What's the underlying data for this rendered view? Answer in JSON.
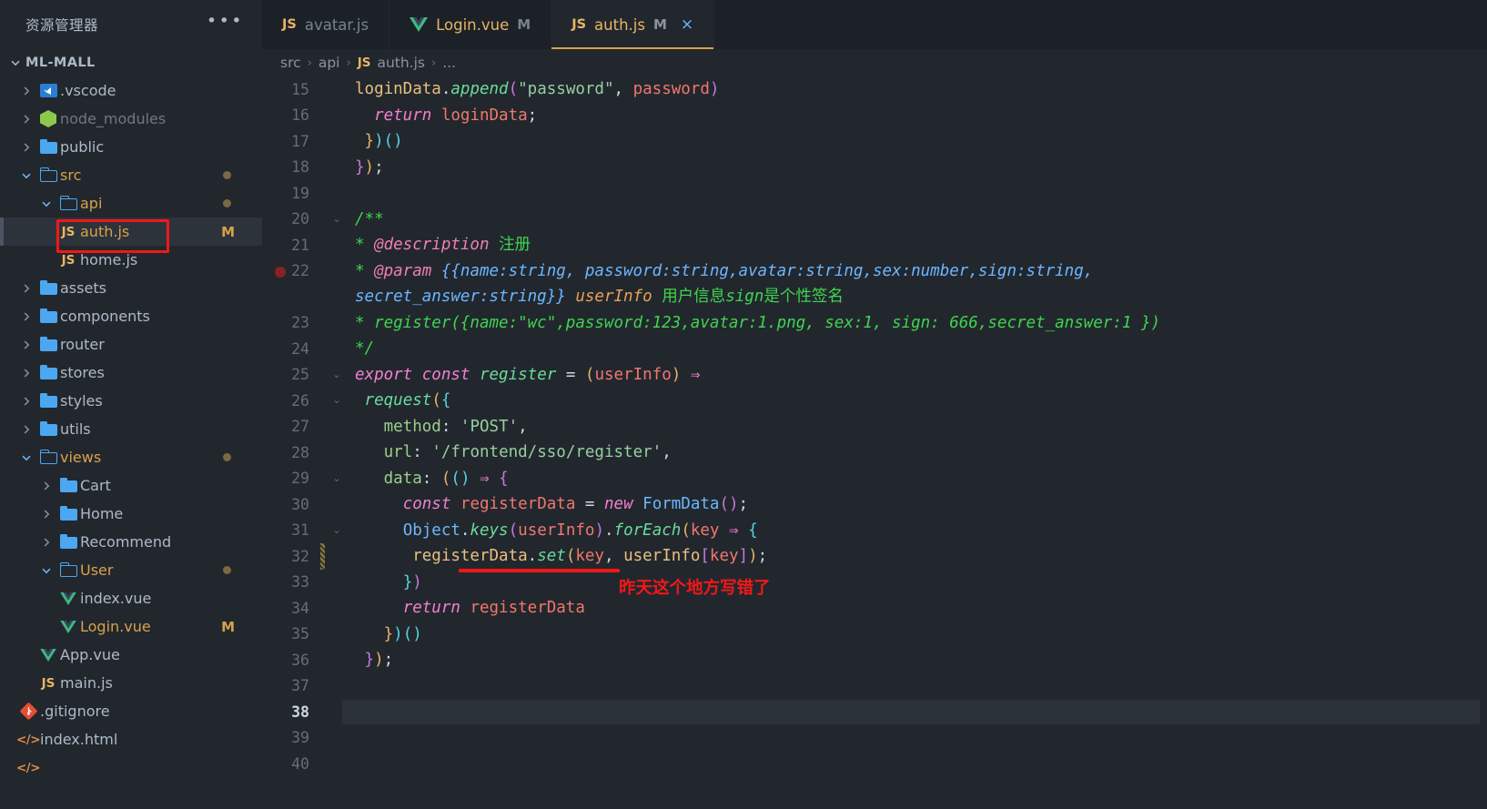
{
  "sidebar": {
    "header_title": "资源管理器",
    "more_icon": "ellipsis-icon",
    "root_label": "ML-MALL",
    "items": [
      {
        "label": ".vscode",
        "indent": 1,
        "type": "folder-vscode",
        "state": "collapsed",
        "badge": "",
        "dot": false
      },
      {
        "label": "node_modules",
        "indent": 1,
        "type": "folder-node",
        "state": "collapsed",
        "badge": "",
        "dot": false,
        "muted": true
      },
      {
        "label": "public",
        "indent": 1,
        "type": "folder",
        "state": "collapsed",
        "badge": "",
        "dot": false
      },
      {
        "label": "src",
        "indent": 1,
        "type": "folder-open",
        "state": "expanded",
        "badge": "",
        "dot": true
      },
      {
        "label": "api",
        "indent": 2,
        "type": "folder-open",
        "state": "expanded",
        "badge": "",
        "dot": true
      },
      {
        "label": "auth.js",
        "indent": 3,
        "type": "js",
        "state": "file",
        "badge": "M",
        "dot": false,
        "selected": true,
        "modified": true
      },
      {
        "label": "home.js",
        "indent": 3,
        "type": "js",
        "state": "file",
        "badge": "",
        "dot": false
      },
      {
        "label": "assets",
        "indent": 1,
        "type": "folder",
        "state": "collapsed",
        "badge": "",
        "dot": false
      },
      {
        "label": "components",
        "indent": 1,
        "type": "folder",
        "state": "collapsed",
        "badge": "",
        "dot": false
      },
      {
        "label": "router",
        "indent": 1,
        "type": "folder",
        "state": "collapsed",
        "badge": "",
        "dot": false
      },
      {
        "label": "stores",
        "indent": 1,
        "type": "folder",
        "state": "collapsed",
        "badge": "",
        "dot": false
      },
      {
        "label": "styles",
        "indent": 1,
        "type": "folder",
        "state": "collapsed",
        "badge": "",
        "dot": false
      },
      {
        "label": "utils",
        "indent": 1,
        "type": "folder",
        "state": "collapsed",
        "badge": "",
        "dot": false
      },
      {
        "label": "views",
        "indent": 1,
        "type": "folder-open",
        "state": "expanded",
        "badge": "",
        "dot": true
      },
      {
        "label": "Cart",
        "indent": 2,
        "type": "folder",
        "state": "collapsed",
        "badge": "",
        "dot": false
      },
      {
        "label": "Home",
        "indent": 2,
        "type": "folder",
        "state": "collapsed",
        "badge": "",
        "dot": false
      },
      {
        "label": "Recommend",
        "indent": 2,
        "type": "folder",
        "state": "collapsed",
        "badge": "",
        "dot": false
      },
      {
        "label": "User",
        "indent": 2,
        "type": "folder-open",
        "state": "expanded",
        "badge": "",
        "dot": true,
        "modified": true
      },
      {
        "label": "index.vue",
        "indent": 3,
        "type": "vue",
        "state": "file",
        "badge": "",
        "dot": false
      },
      {
        "label": "Login.vue",
        "indent": 3,
        "type": "vue",
        "state": "file",
        "badge": "M",
        "dot": false,
        "modified": true
      },
      {
        "label": "App.vue",
        "indent": 2,
        "type": "vue",
        "state": "file",
        "badge": "",
        "dot": false
      },
      {
        "label": "main.js",
        "indent": 2,
        "type": "js",
        "state": "file",
        "badge": "",
        "dot": false
      },
      {
        "label": ".gitignore",
        "indent": 1,
        "type": "git",
        "state": "file",
        "badge": "",
        "dot": false
      },
      {
        "label": "index.html",
        "indent": 1,
        "type": "html",
        "state": "file",
        "badge": "",
        "dot": false
      }
    ]
  },
  "tabs": [
    {
      "icon": "js-file-icon",
      "name": "avatar.js",
      "badge": "",
      "active": false,
      "closable": false
    },
    {
      "icon": "vue-file-icon",
      "name": "Login.vue",
      "badge": "M",
      "active": false,
      "closable": false
    },
    {
      "icon": "js-file-icon",
      "name": "auth.js",
      "badge": "M",
      "active": true,
      "closable": true,
      "close_glyph": "×"
    }
  ],
  "breadcrumb": {
    "items": [
      "src",
      "api",
      "auth.js",
      "..."
    ],
    "file_icon": "js-file-icon",
    "separator": "›"
  },
  "editor": {
    "active_line": 38,
    "breakpoint_line": 22,
    "modified_gutter_line": 32,
    "first_visible_line": 15,
    "last_visible_line": 40,
    "line_numbers": [
      15,
      16,
      17,
      18,
      19,
      20,
      21,
      22,
      23,
      24,
      25,
      26,
      27,
      28,
      29,
      30,
      31,
      32,
      33,
      34,
      35,
      36,
      37,
      38,
      39,
      40
    ],
    "fold_lines": [
      20,
      25,
      26,
      29,
      31
    ]
  },
  "annotations": {
    "sidebar_box_target": "auth.js",
    "code_note_text": "昨天这个地方写错了",
    "accent_color": "#f01818"
  },
  "colors": {
    "background": "#22272e",
    "tabbar": "#1c2128",
    "selection": "#2d333b",
    "active_line": "#2b3139",
    "tab_accent": "#d9a14b",
    "annotation_red": "#f01818"
  }
}
